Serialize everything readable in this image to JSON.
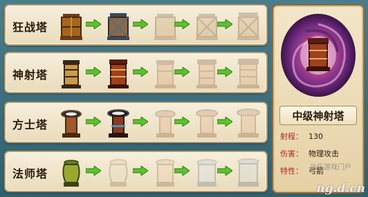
{
  "rows": [
    {
      "name": "狂战塔",
      "stages": [
        "tower-level-1",
        "tower-level-2",
        "tower-level-3",
        "tower-level-4",
        "tower-level-5"
      ]
    },
    {
      "name": "神射塔",
      "stages": [
        "tower-level-1",
        "tower-level-2",
        "tower-level-3",
        "tower-level-4",
        "tower-level-5"
      ]
    },
    {
      "name": "方士塔",
      "stages": [
        "tower-level-1",
        "tower-level-2",
        "tower-level-3",
        "tower-level-4",
        "tower-level-5"
      ]
    },
    {
      "name": "法师塔",
      "stages": [
        "tower-level-1",
        "tower-level-2",
        "tower-level-3",
        "tower-level-4",
        "tower-level-5"
      ]
    }
  ],
  "unlocked_per_row": [
    2,
    2,
    2,
    1
  ],
  "detail": {
    "title": "中级神射塔",
    "range_label": "射程：",
    "range_value": "130",
    "damage_label": "伤害：",
    "damage_value": "物理攻击",
    "trait_label": "特性：",
    "trait_value": "弓箭"
  },
  "watermark": {
    "text": "ng.d.cn",
    "cn_text": "当乐游戏门户"
  },
  "colors": {
    "background": "#3f6f80",
    "panel": "#f1e6c8",
    "arrow_green": "#5ec22e",
    "label_red": "#b0281e",
    "vortex_purple": "#7a2f86",
    "vortex_pink": "#c04a92"
  }
}
